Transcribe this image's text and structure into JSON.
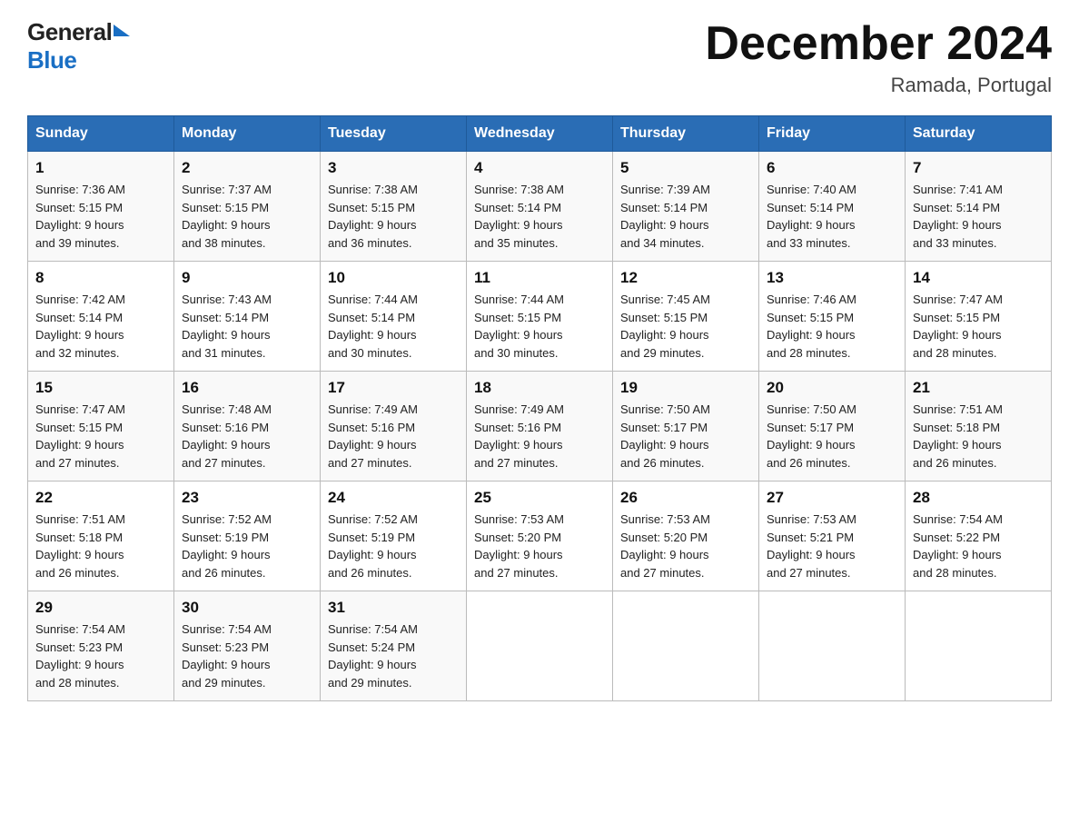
{
  "header": {
    "logo_general": "General",
    "logo_triangle": "",
    "logo_blue": "Blue",
    "month_title": "December 2024",
    "location": "Ramada, Portugal"
  },
  "days_of_week": [
    "Sunday",
    "Monday",
    "Tuesday",
    "Wednesday",
    "Thursday",
    "Friday",
    "Saturday"
  ],
  "weeks": [
    [
      {
        "day": "1",
        "sunrise": "7:36 AM",
        "sunset": "5:15 PM",
        "daylight": "9 hours and 39 minutes."
      },
      {
        "day": "2",
        "sunrise": "7:37 AM",
        "sunset": "5:15 PM",
        "daylight": "9 hours and 38 minutes."
      },
      {
        "day": "3",
        "sunrise": "7:38 AM",
        "sunset": "5:15 PM",
        "daylight": "9 hours and 36 minutes."
      },
      {
        "day": "4",
        "sunrise": "7:38 AM",
        "sunset": "5:14 PM",
        "daylight": "9 hours and 35 minutes."
      },
      {
        "day": "5",
        "sunrise": "7:39 AM",
        "sunset": "5:14 PM",
        "daylight": "9 hours and 34 minutes."
      },
      {
        "day": "6",
        "sunrise": "7:40 AM",
        "sunset": "5:14 PM",
        "daylight": "9 hours and 33 minutes."
      },
      {
        "day": "7",
        "sunrise": "7:41 AM",
        "sunset": "5:14 PM",
        "daylight": "9 hours and 33 minutes."
      }
    ],
    [
      {
        "day": "8",
        "sunrise": "7:42 AM",
        "sunset": "5:14 PM",
        "daylight": "9 hours and 32 minutes."
      },
      {
        "day": "9",
        "sunrise": "7:43 AM",
        "sunset": "5:14 PM",
        "daylight": "9 hours and 31 minutes."
      },
      {
        "day": "10",
        "sunrise": "7:44 AM",
        "sunset": "5:14 PM",
        "daylight": "9 hours and 30 minutes."
      },
      {
        "day": "11",
        "sunrise": "7:44 AM",
        "sunset": "5:15 PM",
        "daylight": "9 hours and 30 minutes."
      },
      {
        "day": "12",
        "sunrise": "7:45 AM",
        "sunset": "5:15 PM",
        "daylight": "9 hours and 29 minutes."
      },
      {
        "day": "13",
        "sunrise": "7:46 AM",
        "sunset": "5:15 PM",
        "daylight": "9 hours and 28 minutes."
      },
      {
        "day": "14",
        "sunrise": "7:47 AM",
        "sunset": "5:15 PM",
        "daylight": "9 hours and 28 minutes."
      }
    ],
    [
      {
        "day": "15",
        "sunrise": "7:47 AM",
        "sunset": "5:15 PM",
        "daylight": "9 hours and 27 minutes."
      },
      {
        "day": "16",
        "sunrise": "7:48 AM",
        "sunset": "5:16 PM",
        "daylight": "9 hours and 27 minutes."
      },
      {
        "day": "17",
        "sunrise": "7:49 AM",
        "sunset": "5:16 PM",
        "daylight": "9 hours and 27 minutes."
      },
      {
        "day": "18",
        "sunrise": "7:49 AM",
        "sunset": "5:16 PM",
        "daylight": "9 hours and 27 minutes."
      },
      {
        "day": "19",
        "sunrise": "7:50 AM",
        "sunset": "5:17 PM",
        "daylight": "9 hours and 26 minutes."
      },
      {
        "day": "20",
        "sunrise": "7:50 AM",
        "sunset": "5:17 PM",
        "daylight": "9 hours and 26 minutes."
      },
      {
        "day": "21",
        "sunrise": "7:51 AM",
        "sunset": "5:18 PM",
        "daylight": "9 hours and 26 minutes."
      }
    ],
    [
      {
        "day": "22",
        "sunrise": "7:51 AM",
        "sunset": "5:18 PM",
        "daylight": "9 hours and 26 minutes."
      },
      {
        "day": "23",
        "sunrise": "7:52 AM",
        "sunset": "5:19 PM",
        "daylight": "9 hours and 26 minutes."
      },
      {
        "day": "24",
        "sunrise": "7:52 AM",
        "sunset": "5:19 PM",
        "daylight": "9 hours and 26 minutes."
      },
      {
        "day": "25",
        "sunrise": "7:53 AM",
        "sunset": "5:20 PM",
        "daylight": "9 hours and 27 minutes."
      },
      {
        "day": "26",
        "sunrise": "7:53 AM",
        "sunset": "5:20 PM",
        "daylight": "9 hours and 27 minutes."
      },
      {
        "day": "27",
        "sunrise": "7:53 AM",
        "sunset": "5:21 PM",
        "daylight": "9 hours and 27 minutes."
      },
      {
        "day": "28",
        "sunrise": "7:54 AM",
        "sunset": "5:22 PM",
        "daylight": "9 hours and 28 minutes."
      }
    ],
    [
      {
        "day": "29",
        "sunrise": "7:54 AM",
        "sunset": "5:23 PM",
        "daylight": "9 hours and 28 minutes."
      },
      {
        "day": "30",
        "sunrise": "7:54 AM",
        "sunset": "5:23 PM",
        "daylight": "9 hours and 29 minutes."
      },
      {
        "day": "31",
        "sunrise": "7:54 AM",
        "sunset": "5:24 PM",
        "daylight": "9 hours and 29 minutes."
      },
      null,
      null,
      null,
      null
    ]
  ],
  "labels": {
    "sunrise": "Sunrise:",
    "sunset": "Sunset:",
    "daylight": "Daylight:"
  }
}
